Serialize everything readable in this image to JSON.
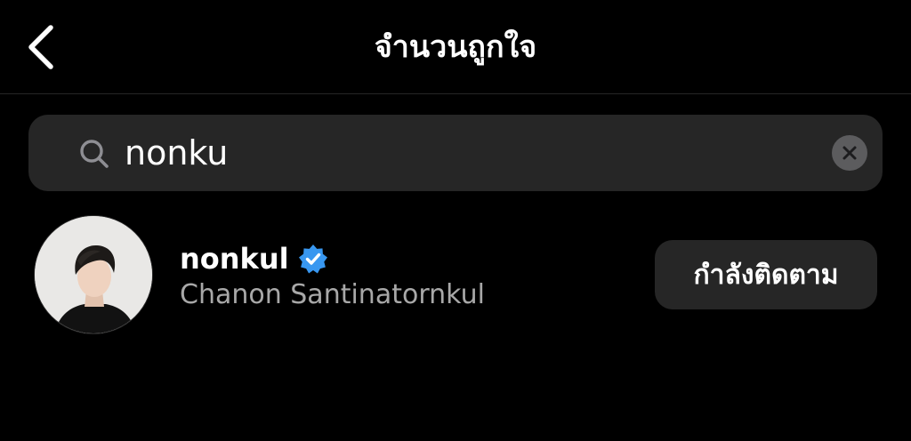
{
  "header": {
    "title": "จำนวนถูกใจ",
    "back_icon": "chevron-left-icon"
  },
  "search": {
    "value": "nonku",
    "icon": "search-icon",
    "clear_icon": "close-icon"
  },
  "results": [
    {
      "username": "nonkul",
      "verified": true,
      "full_name": "Chanon Santinatornkul",
      "follow_label": "กำลังติดตาม"
    }
  ],
  "colors": {
    "background": "#000000",
    "surface": "#262626",
    "text_primary": "#ffffff",
    "text_secondary": "#a8a8a8",
    "verified_blue": "#3897f0"
  }
}
